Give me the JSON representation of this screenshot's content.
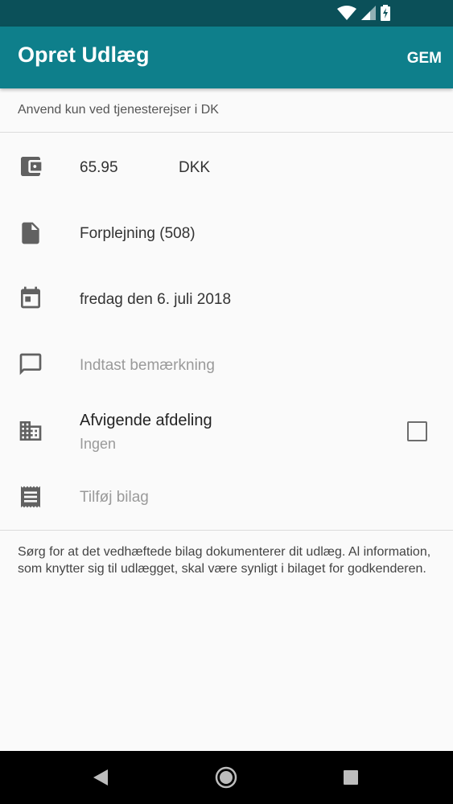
{
  "app": {
    "title": "Opret Udlæg",
    "save_label": "GEM"
  },
  "notice": "Anvend kun ved tjenesterejser i DK",
  "amount": {
    "value": "65.95",
    "currency": "DKK",
    "icon": "wallet-icon"
  },
  "category": {
    "value": "Forplejning (508)",
    "icon": "file-icon"
  },
  "date": {
    "value": "fredag den 6. juli 2018",
    "icon": "calendar-icon"
  },
  "comment": {
    "placeholder": "Indtast bemærkning",
    "icon": "comment-icon"
  },
  "department": {
    "title": "Afvigende afdeling",
    "value": "Ingen",
    "checked": false,
    "icon": "building-icon"
  },
  "attachment": {
    "placeholder": "Tilføj bilag",
    "icon": "receipt-icon"
  },
  "footer_note": "Sørg for at det vedhæftede bilag dokumenterer dit udlæg. Al information, som knytter sig til udlægget, skal være synligt i bilaget for godkenderen.",
  "colors": {
    "status_bar": "#0b5059",
    "app_bar": "#0e7f8b",
    "icon": "#616161"
  }
}
